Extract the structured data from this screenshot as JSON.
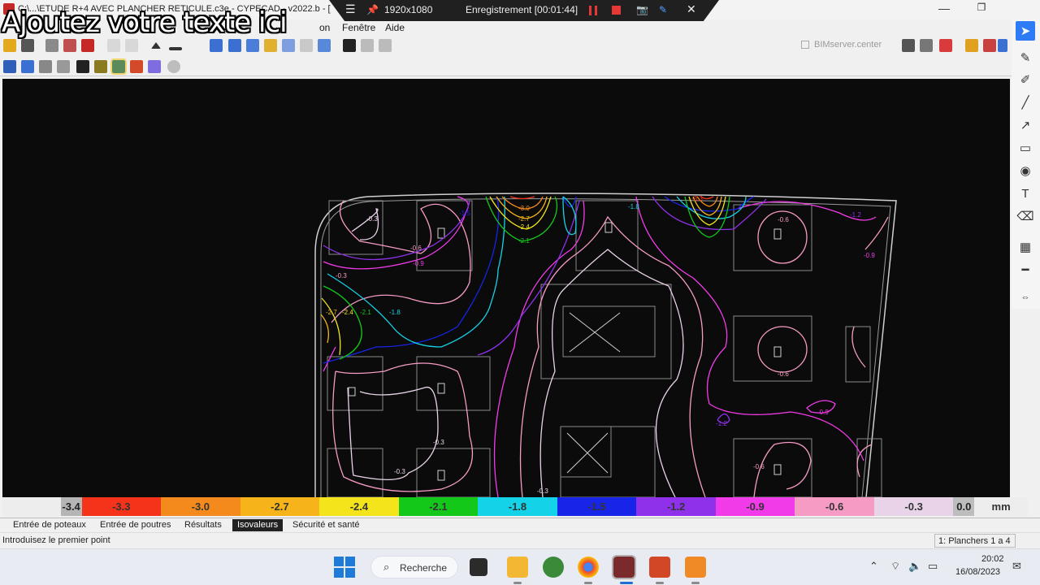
{
  "window": {
    "title": "C:\\...\\ETUDE R+4 AVEC PLANCHER RETICULE.c3e - CYPECAD - v2022.b - ["
  },
  "overlay": {
    "caption": "Ajoutez votre texte ici"
  },
  "recorder": {
    "resolution": "1920x1080",
    "status": "Enregistrement [00:01:44]"
  },
  "menu": {
    "partial_item": "on",
    "fenetre": "Fenêtre",
    "aide": "Aide"
  },
  "toolbar": {
    "bimserver_label": "BIMserver.center"
  },
  "legend": {
    "unit": "mm",
    "cells": [
      {
        "label": "-3.4",
        "color": "#b5b5b5"
      },
      {
        "label": "-3.3",
        "color": "#f5331b"
      },
      {
        "label": "-3.0",
        "color": "#f58a1c"
      },
      {
        "label": "-2.7",
        "color": "#f6b41a"
      },
      {
        "label": "-2.4",
        "color": "#f3e41c"
      },
      {
        "label": "-2.1",
        "color": "#14c819"
      },
      {
        "label": "-1.8",
        "color": "#14d3e8"
      },
      {
        "label": "-1.5",
        "color": "#1725e8"
      },
      {
        "label": "-1.2",
        "color": "#8f31ea"
      },
      {
        "label": "-0.9",
        "color": "#f23be8"
      },
      {
        "label": "-0.6",
        "color": "#f59bc4"
      },
      {
        "label": "-0.3",
        "color": "#e9d3e9"
      },
      {
        "label": "0.0",
        "color": "#bdbdbd"
      }
    ]
  },
  "canvas": {
    "contour_labels": [
      "-0.3",
      "-0.6",
      "-0.9",
      "-3.0",
      "-2.7",
      "-2.4",
      "-2.1",
      "-3.3",
      "-1.8",
      "-1.2",
      "-1.5",
      "-0.3",
      "-0.6",
      "-0.9",
      "-1.2",
      "-0.6",
      "-0.9",
      "-1.8",
      "-2.1",
      "-2.4",
      "-2.7",
      "-0.3",
      "-0.3",
      "-0.6",
      "-0.3"
    ]
  },
  "tabs": [
    {
      "label": "Entrée de poteaux",
      "active": false
    },
    {
      "label": "Entrée de poutres",
      "active": false
    },
    {
      "label": "Résultats",
      "active": false
    },
    {
      "label": "Isovaleurs",
      "active": true
    },
    {
      "label": "Sécurité et santé",
      "active": false
    }
  ],
  "status": {
    "prompt": "Introduisez le premier point",
    "floors": "1: Planchers 1 a 4"
  },
  "taskbar": {
    "search_label": "Recherche",
    "time": "20:02",
    "date": "16/08/2023"
  }
}
